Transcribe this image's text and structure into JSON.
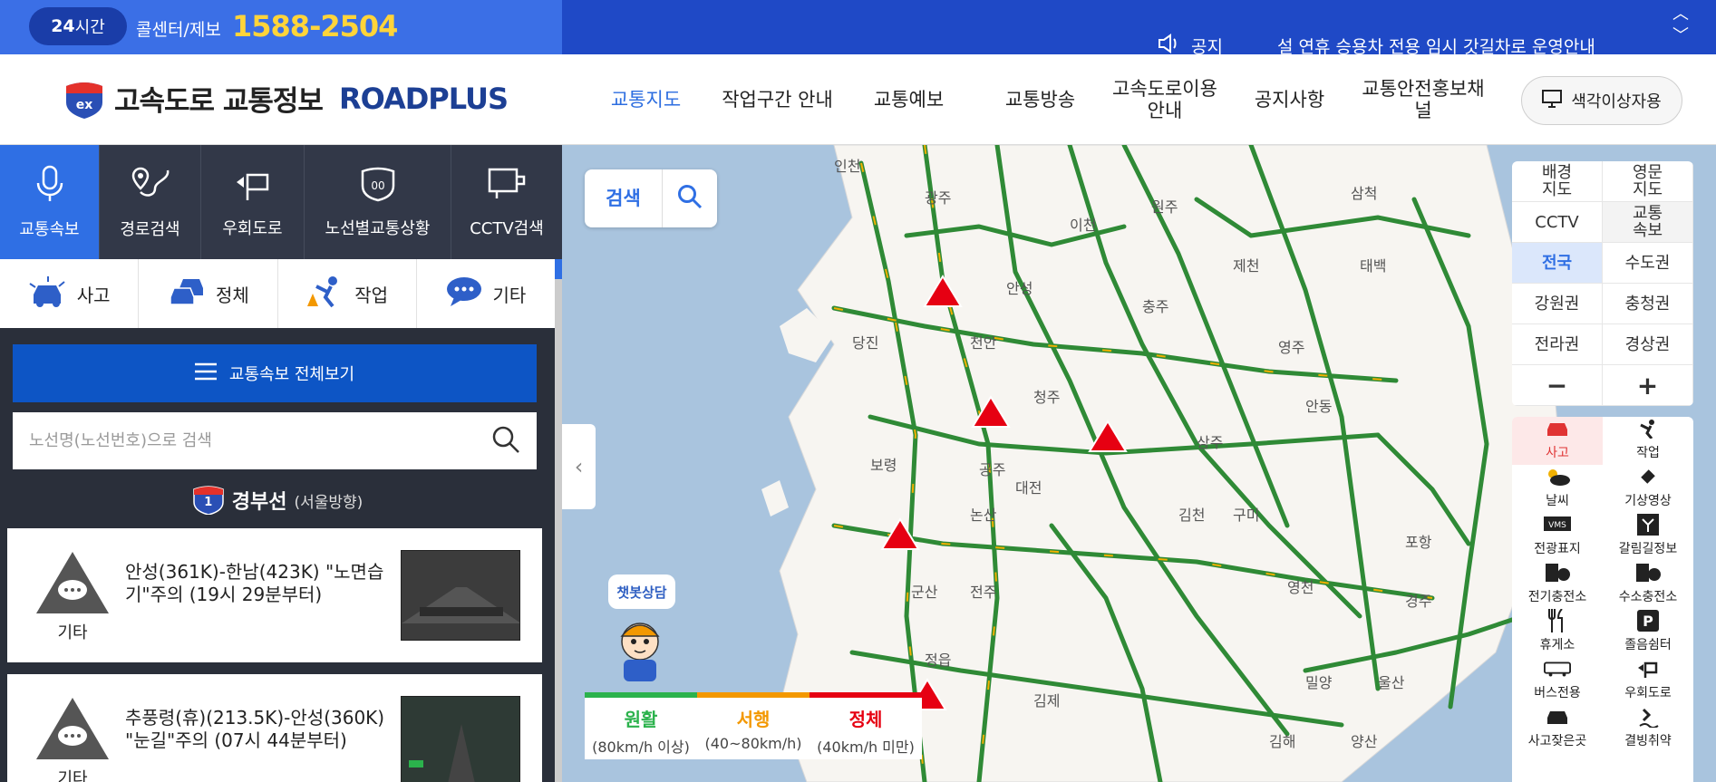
{
  "topbar": {
    "badge_num": "24",
    "badge_unit": "시간",
    "callcenter_label": "콜센터/제보",
    "phone": "1588-2504",
    "notice_label": "공지",
    "notice_text": "설 연휴 승용차 전용 임시 갓길차로 운영안내"
  },
  "header": {
    "logo_title": "고속도로 교통정보",
    "logo_sub": "ROADPLUS",
    "nav": [
      "교통지도",
      "작업구간 안내",
      "교통예보",
      "교통방송",
      "고속도로이용안내",
      "공지사항",
      "교통안전홍보채널"
    ],
    "color_btn": "색각이상자용"
  },
  "sidebar": {
    "tabs": [
      "교통속보",
      "경로검색",
      "우회도로",
      "노선별교통상황",
      "CCTV검색"
    ],
    "categories": [
      "사고",
      "정체",
      "작업",
      "기타"
    ],
    "allview_label": "교통속보 전체보기",
    "search_placeholder": "노선명(노선번호)으로 검색",
    "route_number": "1",
    "route_name": "경부선",
    "route_dir": "(서울방향)",
    "cards": [
      {
        "type": "기타",
        "text": "안성(361K)-한남(423K) \"노면습기\"주의 (19시 29분부터)"
      },
      {
        "type": "기타",
        "text": "추풍령(휴)(213.5K)-안성(360K) \"눈길\"주의 (07시 44분부터)"
      }
    ]
  },
  "map": {
    "search_label": "검색",
    "chatbot_label": "챗봇상담",
    "legend": [
      {
        "name": "원활",
        "range": "(80km/h 이상)",
        "color": "#2bb24c"
      },
      {
        "name": "서행",
        "range": "(40~80km/h)",
        "color": "#f39800"
      },
      {
        "name": "정체",
        "range": "(40km/h 미만)",
        "color": "#e60012"
      }
    ],
    "controls": [
      "배경\n지도",
      "영문\n지도",
      "CCTV",
      "교통\n속보",
      "전국",
      "수도권",
      "강원권",
      "충청권",
      "전라권",
      "경상권",
      "−",
      "+"
    ],
    "layers": [
      "사고",
      "작업",
      "날씨",
      "기상영상",
      "전광표지",
      "갈림길정보",
      "전기충전소",
      "수소충전소",
      "휴게소",
      "졸음쉼터",
      "버스전용",
      "우회도로",
      "사고잦은곳",
      "결빙취약"
    ],
    "cities": [
      "인천",
      "광주",
      "원주",
      "이천",
      "삼척",
      "제천",
      "태백",
      "안성",
      "충주",
      "당진",
      "천안",
      "영주",
      "청주",
      "안동",
      "보령",
      "공주",
      "대전",
      "상주",
      "논산",
      "김천",
      "구미",
      "포항",
      "군산",
      "전주",
      "영천",
      "경주",
      "정읍",
      "김제",
      "밀양",
      "울산",
      "김해",
      "양산"
    ]
  }
}
